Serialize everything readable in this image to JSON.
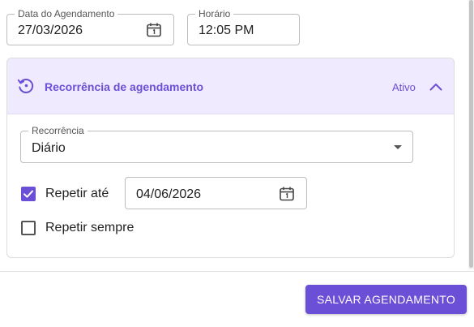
{
  "schedule": {
    "date_label": "Data do Agendamento",
    "date_value": "27/03/2026",
    "time_label": "Horário",
    "time_value": "12:05 PM"
  },
  "recurrence": {
    "title": "Recorrência de agendamento",
    "status": "Ativo",
    "expanded": true,
    "type_label": "Recorrência",
    "type_value": "Diário",
    "repeat_until": {
      "label": "Repetir até",
      "checked": true,
      "date": "04/06/2026"
    },
    "repeat_always": {
      "label": "Repetir sempre",
      "checked": false
    }
  },
  "footer": {
    "save_label": "SALVAR AGENDAMENTO"
  },
  "icons": {
    "calendar": "calendar-icon",
    "history": "history-icon",
    "chevron": "chevron-up-icon",
    "checkmark": "checkmark-icon",
    "dropdown": "dropdown-arrow-icon"
  },
  "colors": {
    "accent": "#6b4fd6",
    "accordion_header": "#efeafd"
  }
}
